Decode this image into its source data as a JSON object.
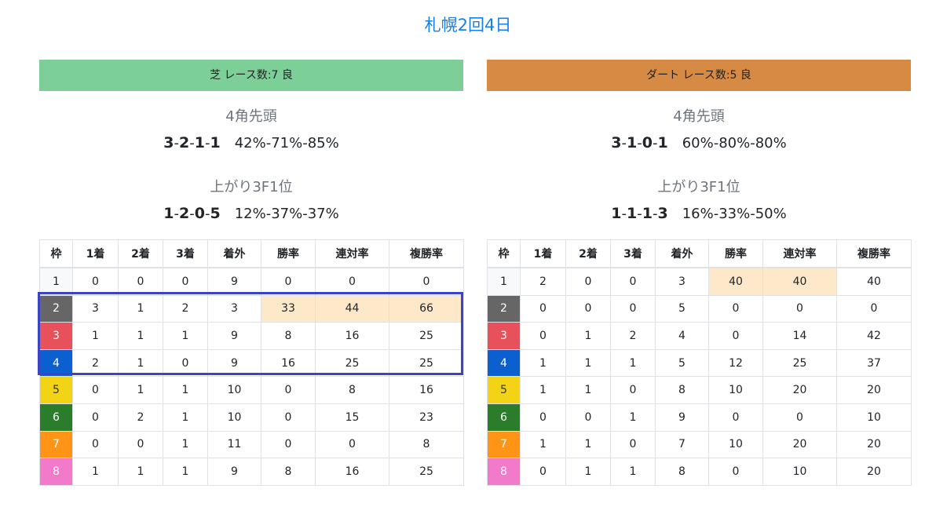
{
  "title": "札幌2回4日",
  "colors": {
    "title": "#1a7ee8",
    "turf_banner": "#7dcf98",
    "dirt_banner": "#d68a43",
    "highlight_cell": "#fde9c9",
    "selection_box": "#3b44c4"
  },
  "headers": [
    "枠",
    "1着",
    "2着",
    "3着",
    "着外",
    "勝率",
    "連対率",
    "複勝率"
  ],
  "turf": {
    "banner": "芝 レース数:7  良",
    "corner_label": "4角先頭",
    "corner_record": [
      "3",
      "2",
      "1",
      "1"
    ],
    "corner_pct": "42%-71%-85%",
    "last3f_label": "上がり3F1位",
    "last3f_record": [
      "1",
      "2",
      "0",
      "5"
    ],
    "last3f_pct": "12%-37%-37%",
    "rows": [
      {
        "waku": "1",
        "v": [
          "0",
          "0",
          "0",
          "9",
          "0",
          "0",
          "0"
        ],
        "hl": []
      },
      {
        "waku": "2",
        "v": [
          "3",
          "1",
          "2",
          "3",
          "33",
          "44",
          "66"
        ],
        "hl": [
          4,
          5,
          6
        ]
      },
      {
        "waku": "3",
        "v": [
          "1",
          "1",
          "1",
          "9",
          "8",
          "16",
          "25"
        ],
        "hl": []
      },
      {
        "waku": "4",
        "v": [
          "2",
          "1",
          "0",
          "9",
          "16",
          "25",
          "25"
        ],
        "hl": []
      },
      {
        "waku": "5",
        "v": [
          "0",
          "1",
          "1",
          "10",
          "0",
          "8",
          "16"
        ],
        "hl": []
      },
      {
        "waku": "6",
        "v": [
          "0",
          "2",
          "1",
          "10",
          "0",
          "15",
          "23"
        ],
        "hl": []
      },
      {
        "waku": "7",
        "v": [
          "0",
          "0",
          "1",
          "11",
          "0",
          "0",
          "8"
        ],
        "hl": []
      },
      {
        "waku": "8",
        "v": [
          "1",
          "1",
          "1",
          "9",
          "8",
          "16",
          "25"
        ],
        "hl": []
      }
    ]
  },
  "dirt": {
    "banner": "ダート レース数:5  良",
    "corner_label": "4角先頭",
    "corner_record": [
      "3",
      "1",
      "0",
      "1"
    ],
    "corner_pct": "60%-80%-80%",
    "last3f_label": "上がり3F1位",
    "last3f_record": [
      "1",
      "1",
      "1",
      "3"
    ],
    "last3f_pct": "16%-33%-50%",
    "rows": [
      {
        "waku": "1",
        "v": [
          "2",
          "0",
          "0",
          "3",
          "40",
          "40",
          "40"
        ],
        "hl": [
          4,
          5
        ]
      },
      {
        "waku": "2",
        "v": [
          "0",
          "0",
          "0",
          "5",
          "0",
          "0",
          "0"
        ],
        "hl": []
      },
      {
        "waku": "3",
        "v": [
          "0",
          "1",
          "2",
          "4",
          "0",
          "14",
          "42"
        ],
        "hl": []
      },
      {
        "waku": "4",
        "v": [
          "1",
          "1",
          "1",
          "5",
          "12",
          "25",
          "37"
        ],
        "hl": []
      },
      {
        "waku": "5",
        "v": [
          "1",
          "1",
          "0",
          "8",
          "10",
          "20",
          "20"
        ],
        "hl": []
      },
      {
        "waku": "6",
        "v": [
          "0",
          "0",
          "1",
          "9",
          "0",
          "0",
          "10"
        ],
        "hl": []
      },
      {
        "waku": "7",
        "v": [
          "1",
          "1",
          "0",
          "7",
          "10",
          "20",
          "20"
        ],
        "hl": []
      },
      {
        "waku": "8",
        "v": [
          "0",
          "1",
          "1",
          "8",
          "0",
          "10",
          "20"
        ],
        "hl": []
      }
    ]
  }
}
